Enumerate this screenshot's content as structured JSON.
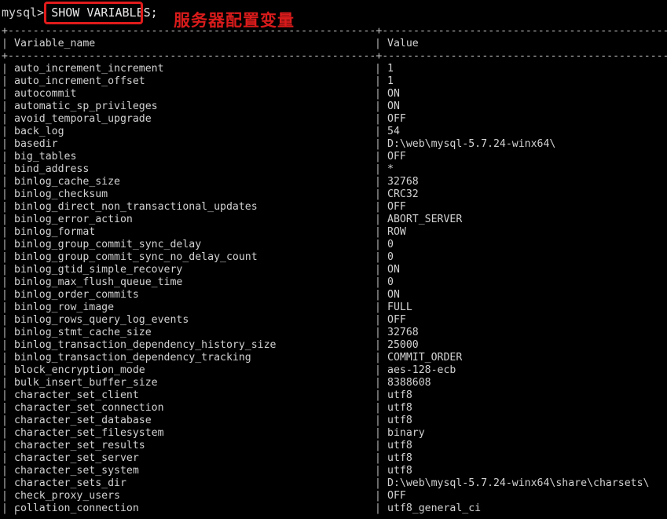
{
  "terminal": {
    "prompt": "mysql> ",
    "command": "SHOW VARIABLES;",
    "annotation": "服务器配置变量",
    "annotation_color": "#d91b1b",
    "highlight_box_color": "#e01b1b",
    "background_color": "#000000",
    "text_color": "#c8c8c8",
    "partial_next_row": "  | ",
    "separator_char": "+",
    "separator_fill": "-",
    "column_bar": "|"
  },
  "table": {
    "headers": [
      "Variable_name",
      "Value"
    ],
    "rows": [
      {
        "name": "auto_increment_increment",
        "value": "1"
      },
      {
        "name": "auto_increment_offset",
        "value": "1"
      },
      {
        "name": "autocommit",
        "value": "ON"
      },
      {
        "name": "automatic_sp_privileges",
        "value": "ON"
      },
      {
        "name": "avoid_temporal_upgrade",
        "value": "OFF"
      },
      {
        "name": "back_log",
        "value": "54"
      },
      {
        "name": "basedir",
        "value": "D:\\web\\mysql-5.7.24-winx64\\"
      },
      {
        "name": "big_tables",
        "value": "OFF"
      },
      {
        "name": "bind_address",
        "value": "*"
      },
      {
        "name": "binlog_cache_size",
        "value": "32768"
      },
      {
        "name": "binlog_checksum",
        "value": "CRC32"
      },
      {
        "name": "binlog_direct_non_transactional_updates",
        "value": "OFF"
      },
      {
        "name": "binlog_error_action",
        "value": "ABORT_SERVER"
      },
      {
        "name": "binlog_format",
        "value": "ROW"
      },
      {
        "name": "binlog_group_commit_sync_delay",
        "value": "0"
      },
      {
        "name": "binlog_group_commit_sync_no_delay_count",
        "value": "0"
      },
      {
        "name": "binlog_gtid_simple_recovery",
        "value": "ON"
      },
      {
        "name": "binlog_max_flush_queue_time",
        "value": "0"
      },
      {
        "name": "binlog_order_commits",
        "value": "ON"
      },
      {
        "name": "binlog_row_image",
        "value": "FULL"
      },
      {
        "name": "binlog_rows_query_log_events",
        "value": "OFF"
      },
      {
        "name": "binlog_stmt_cache_size",
        "value": "32768"
      },
      {
        "name": "binlog_transaction_dependency_history_size",
        "value": "25000"
      },
      {
        "name": "binlog_transaction_dependency_tracking",
        "value": "COMMIT_ORDER"
      },
      {
        "name": "block_encryption_mode",
        "value": "aes-128-ecb"
      },
      {
        "name": "bulk_insert_buffer_size",
        "value": "8388608"
      },
      {
        "name": "character_set_client",
        "value": "utf8"
      },
      {
        "name": "character_set_connection",
        "value": "utf8"
      },
      {
        "name": "character_set_database",
        "value": "utf8"
      },
      {
        "name": "character_set_filesystem",
        "value": "binary"
      },
      {
        "name": "character_set_results",
        "value": "utf8"
      },
      {
        "name": "character_set_server",
        "value": "utf8"
      },
      {
        "name": "character_set_system",
        "value": "utf8"
      },
      {
        "name": "character_sets_dir",
        "value": "D:\\web\\mysql-5.7.24-winx64\\share\\charsets\\"
      },
      {
        "name": "check_proxy_users",
        "value": "OFF"
      },
      {
        "name": "collation_connection",
        "value": "utf8_general_ci"
      }
    ]
  }
}
